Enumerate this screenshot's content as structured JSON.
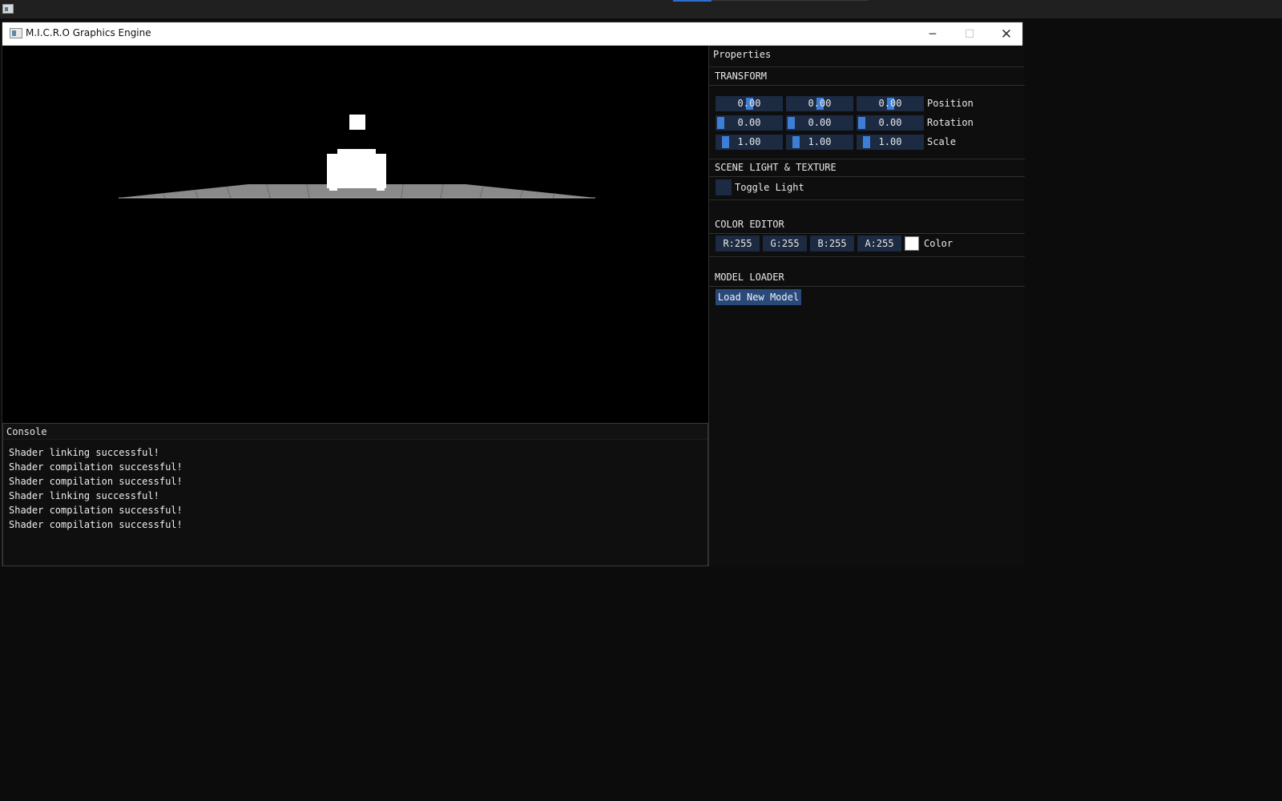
{
  "window": {
    "title": "M.I.C.R.O Graphics Engine",
    "minimize_glyph": "─",
    "maximize_glyph": "☐",
    "close_glyph": "✕"
  },
  "console": {
    "title": "Console",
    "lines": [
      "Shader linking successful!",
      "Shader compilation successful!",
      "Shader compilation successful!",
      "Shader linking successful!",
      "Shader compilation successful!",
      "Shader compilation successful!"
    ]
  },
  "properties": {
    "title": "Properties",
    "transform": {
      "title": "TRANSFORM",
      "position": {
        "label": "Position",
        "values": [
          "0.00",
          "0.00",
          "0.00"
        ]
      },
      "rotation": {
        "label": "Rotation",
        "values": [
          "0.00",
          "0.00",
          "0.00"
        ]
      },
      "scale": {
        "label": "Scale",
        "values": [
          "1.00",
          "1.00",
          "1.00"
        ]
      }
    },
    "scene": {
      "title": "SCENE LIGHT & TEXTURE",
      "toggle_label": "Toggle Light",
      "toggle_checked": false
    },
    "color_editor": {
      "title": "COLOR EDITOR",
      "r": "R:255",
      "g": "G:255",
      "b": "B:255",
      "a": "A:255",
      "label": "Color",
      "swatch_color": "#ffffff"
    },
    "model_loader": {
      "title": "MODEL LOADER",
      "button_label": "Load New Model"
    }
  },
  "colors": {
    "accent": "#3d7fd6",
    "frame_bg": "#1c2a42",
    "button_bg": "#28497a"
  },
  "icons": [
    "app-icon",
    "minimize-icon",
    "maximize-icon",
    "close-icon"
  ]
}
